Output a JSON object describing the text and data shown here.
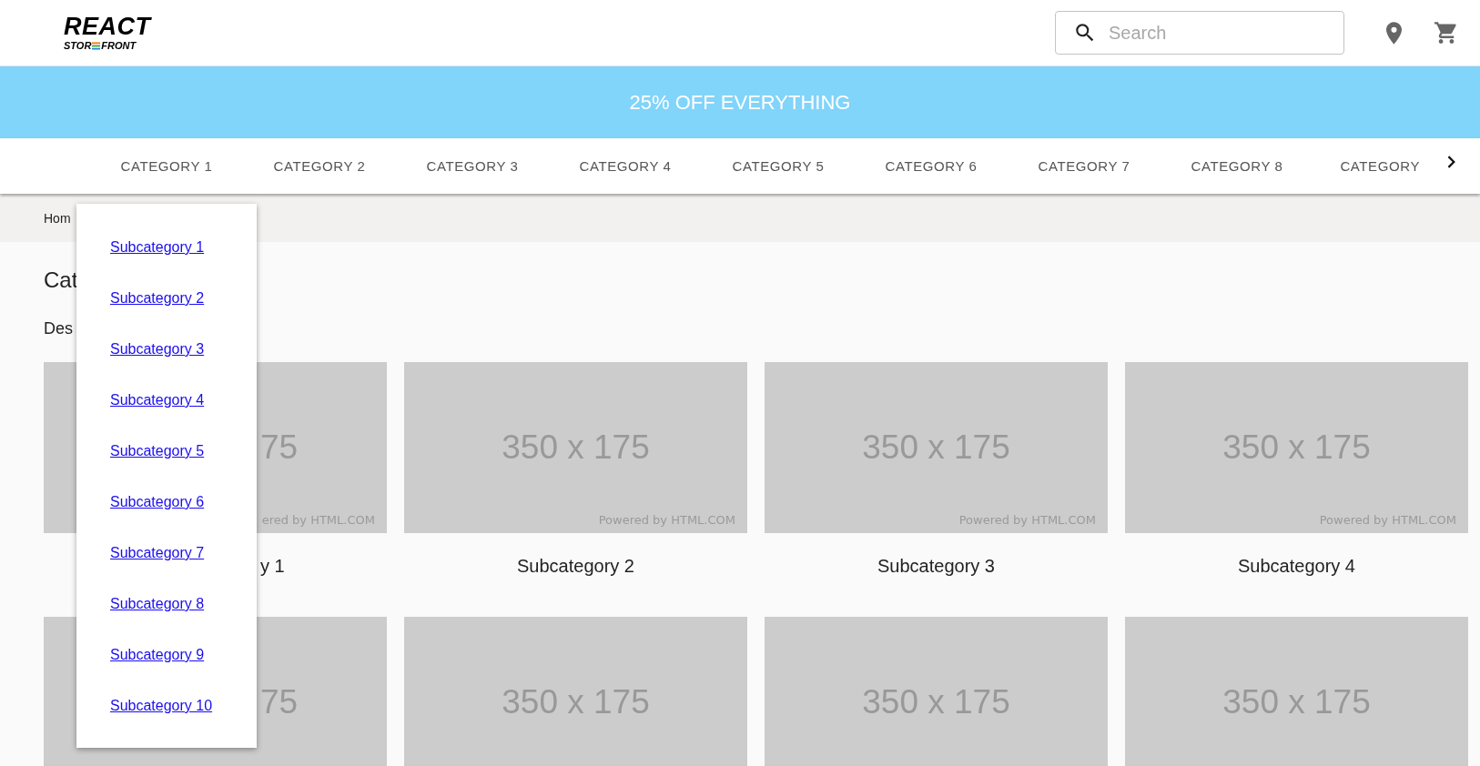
{
  "header": {
    "logo": {
      "top": "REACT",
      "bottom_left": "STOR",
      "bottom_right": "FRONT"
    },
    "search": {
      "placeholder": "Search"
    }
  },
  "banner": {
    "text": "25% OFF EVERYTHING"
  },
  "categories": [
    "CATEGORY 1",
    "CATEGORY 2",
    "CATEGORY 3",
    "CATEGORY 4",
    "CATEGORY 5",
    "CATEGORY 6",
    "CATEGORY 7",
    "CATEGORY 8",
    "CATEGORY"
  ],
  "breadcrumb": "Hom",
  "title": "Cat",
  "description": "Des",
  "cards": [
    {
      "image_label": "75",
      "image_credit": "ered by HTML.COM",
      "caption": "y 1",
      "covered": true
    },
    {
      "image_label": "350 x 175",
      "image_credit": "Powered by HTML.COM",
      "caption": "Subcategory 2",
      "covered": false
    },
    {
      "image_label": "350 x 175",
      "image_credit": "Powered by HTML.COM",
      "caption": "Subcategory 3",
      "covered": false
    },
    {
      "image_label": "350 x 175",
      "image_credit": "Powered by HTML.COM",
      "caption": "Subcategory 4",
      "covered": false
    },
    {
      "image_label": "75",
      "covered": true
    },
    {
      "image_label": "350 x 175",
      "covered": false
    },
    {
      "image_label": "350 x 175",
      "covered": false
    },
    {
      "image_label": "350 x 175",
      "covered": false
    }
  ],
  "dropdown": [
    "Subcategory 1",
    "Subcategory 2",
    "Subcategory 3",
    "Subcategory 4",
    "Subcategory 5",
    "Subcategory 6",
    "Subcategory 7",
    "Subcategory 8",
    "Subcategory 9",
    "Subcategory 10"
  ]
}
